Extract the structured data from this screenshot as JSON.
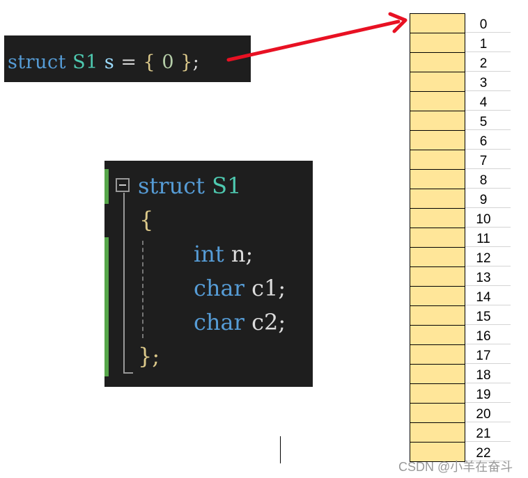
{
  "init_snippet": {
    "kw": "struct",
    "type": "S1",
    "var": "s",
    "eq": "=",
    "lbrace": "{",
    "zero": "0",
    "rbrace": "}",
    "semi": ";"
  },
  "struct_def": {
    "kw": "struct",
    "name": "S1",
    "open": "{",
    "members": [
      {
        "type": "int",
        "name": "n;"
      },
      {
        "type": "char",
        "name": "c1;"
      },
      {
        "type": "char",
        "name": "c2;"
      }
    ],
    "close": "};"
  },
  "memory": {
    "offsets": [
      "0",
      "1",
      "2",
      "3",
      "4",
      "5",
      "6",
      "7",
      "8",
      "9",
      "10",
      "11",
      "12",
      "13",
      "14",
      "15",
      "16",
      "17",
      "18",
      "19",
      "20",
      "21",
      "22"
    ],
    "cell_color": "#ffe699"
  },
  "arrow_color": "#e81123",
  "watermark": "CSDN @小羊在奋斗"
}
